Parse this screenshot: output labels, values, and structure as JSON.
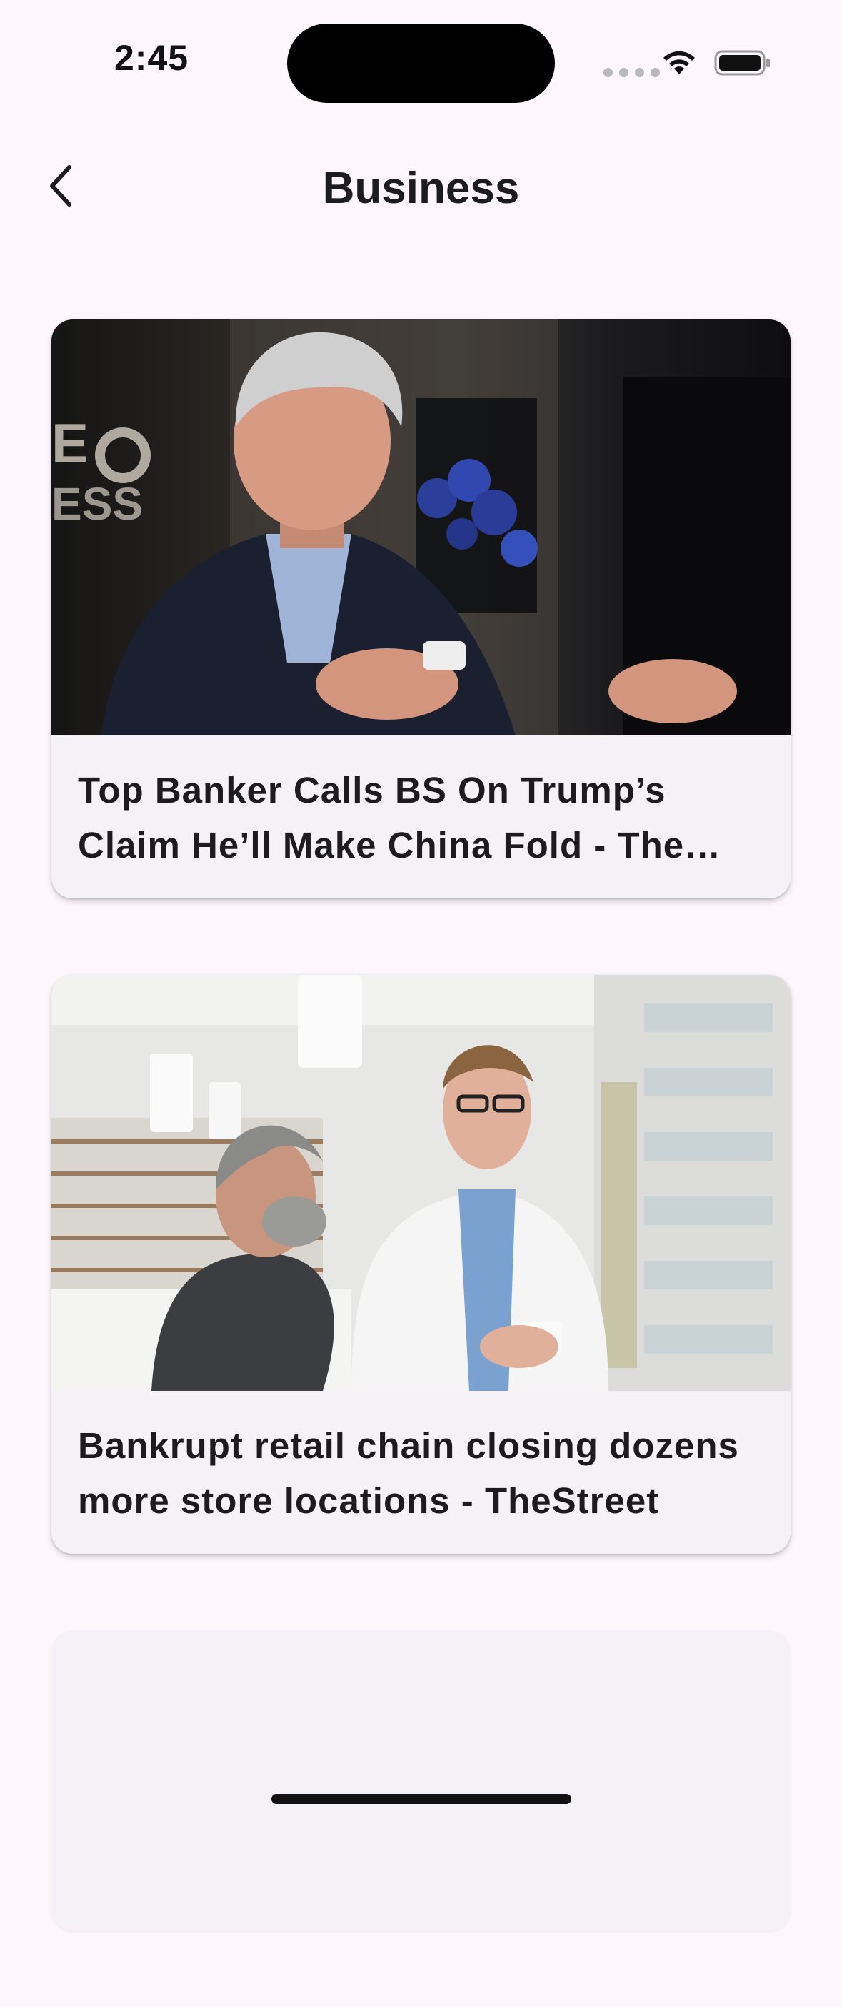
{
  "status_bar": {
    "time": "2:45"
  },
  "app_bar": {
    "title": "Business",
    "back_icon": "chevron-left-icon"
  },
  "articles": [
    {
      "title": "Top Banker Calls BS On Trump’s Claim He’ll Make China Fold - The Daily Beast",
      "image": "banker-interview-photo"
    },
    {
      "title": "Bankrupt retail chain closing dozens more store locations - TheStreet",
      "image": "pharmacy-consultation-photo"
    },
    {
      "title": "",
      "image": ""
    }
  ],
  "colors": {
    "background": "#fdf7fc",
    "card": "#f5f2f7",
    "text": "#1c1b1f"
  }
}
